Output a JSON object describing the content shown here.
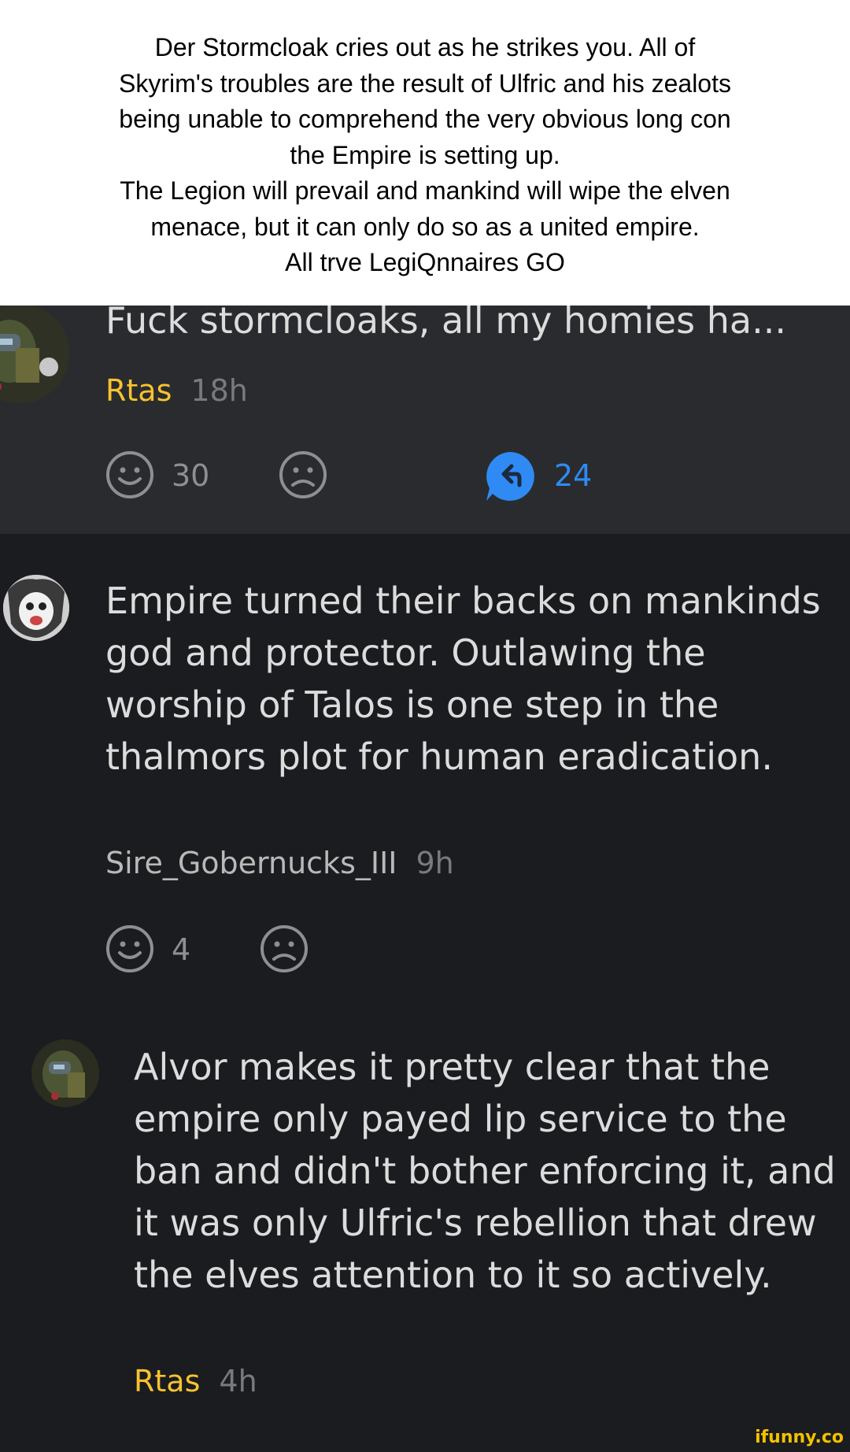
{
  "caption": {
    "lines": [
      "Der Stormcloak cries out as he strikes you. All of",
      "Skyrim's troubles are the result of Ulfric and his zealots",
      "being unable to comprehend the very obvious long con",
      "the Empire is setting up.",
      "The Legion will prevail and mankind will wipe the elven",
      "menace, but it can only do so as a united empire.",
      "All trve LegiQnnaires GO"
    ]
  },
  "comment1": {
    "text": "Fuck stormcloaks, all my homies ha...",
    "username": "Rtas",
    "time": "18h",
    "likes": "30",
    "replies": "24"
  },
  "comment2": {
    "text": "Empire turned their backs on mankinds god and protector. Outlawing the worship of Talos is one step in the thalmors plot for human eradication.",
    "username": "Sire_Gobernucks_III",
    "time": "9h",
    "likes": "4"
  },
  "comment3": {
    "text": "Alvor makes it pretty clear that the empire only payed lip service to the ban and didn't bother enforcing it, and it was only Ulfric's rebellion that drew the elves attention to it so actively.",
    "username": "Rtas",
    "time": "4h"
  },
  "watermark": "ifunny.co",
  "colors": {
    "username_highlight": "#f7c32e",
    "reply_accent": "#2f8bf3",
    "background_dark": "#1b1c1f",
    "background_highlight": "#2a2b2f"
  }
}
